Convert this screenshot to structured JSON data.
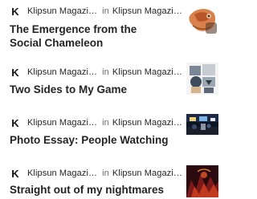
{
  "feed": {
    "items": [
      {
        "author": "Klipsun Magazi…",
        "in_label": "in",
        "publication": "Klipsun Magazi…",
        "publication_initial": "K",
        "title": "The Emergence from the Social Chameleon",
        "thumbnail_icon": "chameleon-thumbnail"
      },
      {
        "author": "Klipsun Magazi…",
        "in_label": "in",
        "publication": "Klipsun Magazi…",
        "publication_initial": "K",
        "title": "Two Sides to My Game",
        "thumbnail_icon": "collage-thumbnail"
      },
      {
        "author": "Klipsun Magazi…",
        "in_label": "in",
        "publication": "Klipsun Magazi…",
        "publication_initial": "K",
        "title": "Photo Essay: People Watching",
        "thumbnail_icon": "night-street-thumbnail"
      },
      {
        "author": "Klipsun Magazi…",
        "in_label": "in",
        "publication": "Klipsun Magazi…",
        "publication_initial": "K",
        "title": "Straight out of my nightmares",
        "thumbnail_icon": "nightmare-thumbnail"
      }
    ]
  }
}
